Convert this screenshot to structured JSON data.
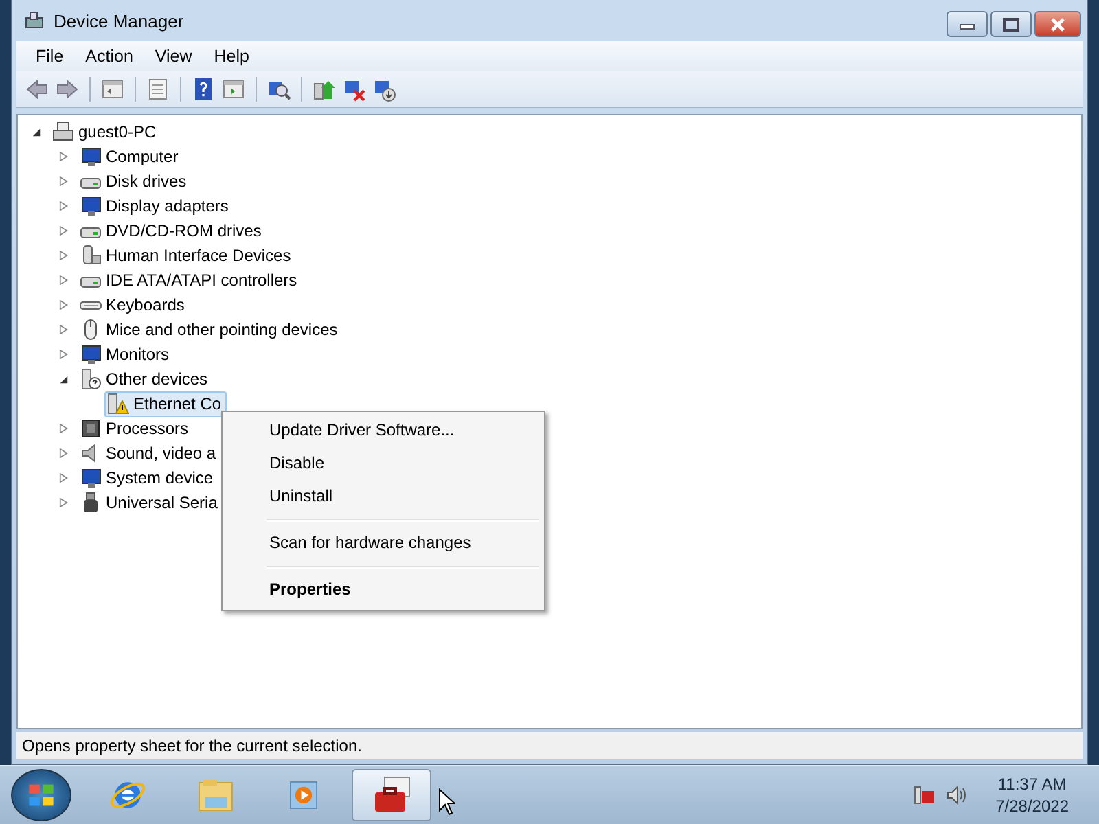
{
  "window": {
    "title": "Device Manager"
  },
  "menu_bar": [
    "File",
    "Action",
    "View",
    "Help"
  ],
  "tree": {
    "label": "guest0-PC",
    "kind": "computer",
    "expanded": true,
    "selected": false,
    "children": [
      {
        "label": "Computer",
        "kind": "monitor",
        "expanded": false,
        "selected": false
      },
      {
        "label": "Disk drives",
        "kind": "drive",
        "expanded": false,
        "selected": false
      },
      {
        "label": "Display adapters",
        "kind": "monitor",
        "expanded": false,
        "selected": false
      },
      {
        "label": "DVD/CD-ROM drives",
        "kind": "drive",
        "expanded": false,
        "selected": false
      },
      {
        "label": "Human Interface Devices",
        "kind": "device",
        "expanded": false,
        "selected": false
      },
      {
        "label": "IDE ATA/ATAPI controllers",
        "kind": "drive",
        "expanded": false,
        "selected": false
      },
      {
        "label": "Keyboards",
        "kind": "keyboard",
        "expanded": false,
        "selected": false
      },
      {
        "label": "Mice and other pointing devices",
        "kind": "mouse",
        "expanded": false,
        "selected": false
      },
      {
        "label": "Monitors",
        "kind": "monitor",
        "expanded": false,
        "selected": false
      },
      {
        "label": "Other devices",
        "kind": "unknown",
        "expanded": true,
        "selected": false,
        "children": [
          {
            "label": "Ethernet Co",
            "kind": "warning",
            "selected": true
          }
        ]
      },
      {
        "label": "Processors",
        "kind": "chip",
        "expanded": false,
        "selected": false
      },
      {
        "label": "Sound, video a",
        "kind": "speaker",
        "expanded": false,
        "selected": false
      },
      {
        "label": "System device",
        "kind": "monitor",
        "expanded": false,
        "selected": false
      },
      {
        "label": "Universal Seria",
        "kind": "usb",
        "expanded": false,
        "selected": false
      }
    ]
  },
  "context_menu": [
    {
      "kind": "item",
      "label": "Update Driver Software...",
      "default": false
    },
    {
      "kind": "item",
      "label": "Disable",
      "default": false
    },
    {
      "kind": "item",
      "label": "Uninstall",
      "default": false
    },
    {
      "kind": "separator"
    },
    {
      "kind": "item",
      "label": "Scan for hardware changes",
      "default": false
    },
    {
      "kind": "separator"
    },
    {
      "kind": "item",
      "label": "Properties",
      "default": true
    }
  ],
  "status_bar": "Opens property sheet for the current selection.",
  "taskbar": {
    "apps": [
      {
        "kind": "browser",
        "selected": false
      },
      {
        "kind": "folder",
        "selected": false
      },
      {
        "kind": "media",
        "selected": false
      },
      {
        "kind": "toolbox",
        "selected": true
      }
    ],
    "time": "11:37 AM",
    "date": "7/28/2022"
  }
}
